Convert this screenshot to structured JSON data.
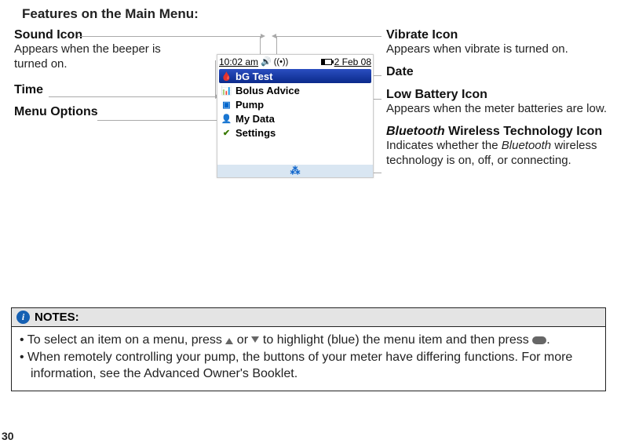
{
  "title": "Features on the Main Menu:",
  "left": {
    "sound": {
      "title": "Sound Icon",
      "desc": "Appears when the beeper is turned on."
    },
    "time": {
      "title": "Time"
    },
    "menu_options": {
      "title": "Menu Options"
    }
  },
  "right": {
    "vibrate": {
      "title": "Vibrate Icon",
      "desc": "Appears when vibrate is turned on."
    },
    "date": {
      "title": "Date"
    },
    "battery": {
      "title": "Low Battery Icon",
      "desc": "Appears when the meter batteries are low."
    },
    "bluetooth": {
      "title_italic": "Bluetooth",
      "title_rest": " Wireless Technology Icon",
      "desc_prefix": "Indicates whether the ",
      "desc_italic": "Bluetooth",
      "desc_suffix": " wireless technology is on, off, or connecting."
    }
  },
  "device": {
    "time": "10:02 am",
    "date": "2 Feb 08",
    "menu": [
      {
        "label": "bG Test",
        "selected": true
      },
      {
        "label": "Bolus Advice",
        "selected": false
      },
      {
        "label": "Pump",
        "selected": false
      },
      {
        "label": "My Data",
        "selected": false
      },
      {
        "label": "Settings",
        "selected": false
      }
    ]
  },
  "notes": {
    "heading": "NOTES:",
    "bullets": [
      {
        "prefix": "To select an item on a menu, press ",
        "mid": " or ",
        "mid2": " to highlight (blue) the menu item and then press ",
        "suffix": "."
      },
      {
        "text": "When remotely controlling your pump, the buttons of your meter have differing functions. For more information, see the Advanced Owner's Booklet."
      }
    ]
  },
  "page_number": "30"
}
